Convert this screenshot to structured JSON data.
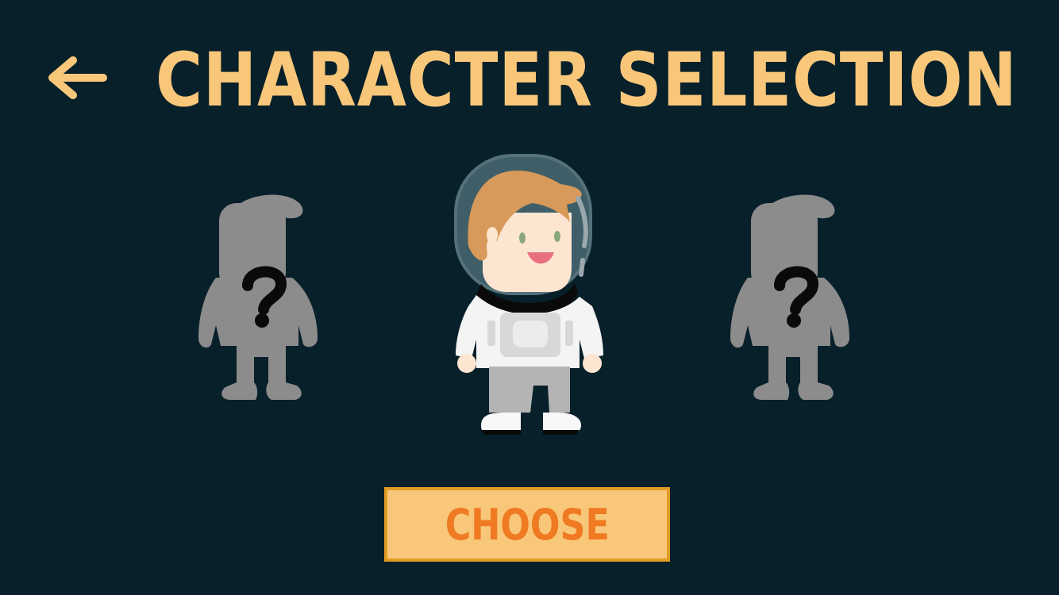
{
  "screen": {
    "title": "CHARACTER SELECTION"
  },
  "nav": {
    "back_icon": "arrow-left-icon"
  },
  "characters": [
    {
      "slot": "left",
      "state": "locked",
      "icon": "question-mark-icon",
      "label": "?"
    },
    {
      "slot": "center",
      "state": "selected",
      "name": "astronaut"
    },
    {
      "slot": "right",
      "state": "locked",
      "icon": "question-mark-icon",
      "label": "?"
    }
  ],
  "actions": {
    "choose_label": "CHOOSE"
  },
  "colors": {
    "background": "#08202a",
    "accent": "#f8c77a",
    "button_border": "#e19a23",
    "button_text": "#ef7a22",
    "locked_silhouette": "#8c8c8c"
  }
}
